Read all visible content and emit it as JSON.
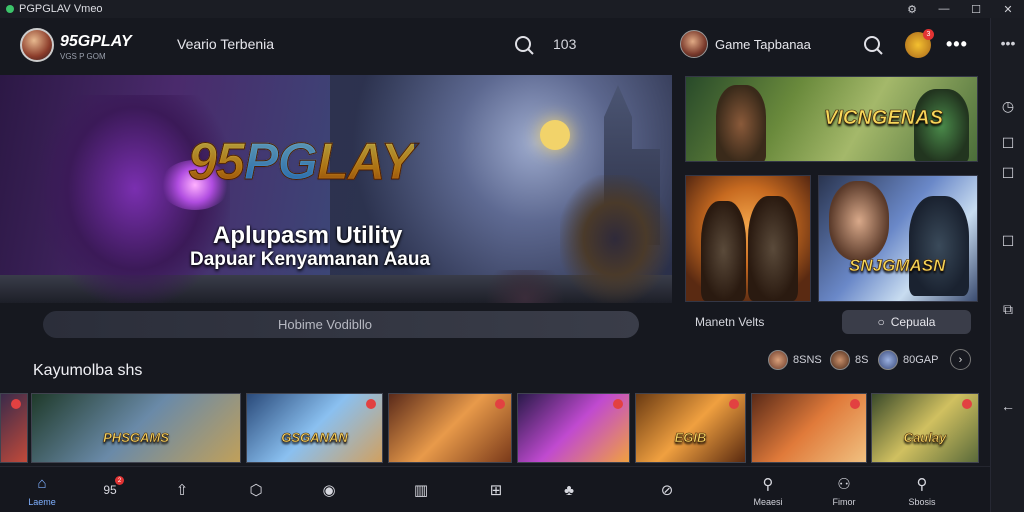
{
  "window": {
    "title": "PGPGLAV Vmeo",
    "controls": [
      "⚙",
      "—",
      "☐",
      "✕"
    ]
  },
  "header": {
    "brand_name": "95GPLAY",
    "brand_sub": "VGS P GOM",
    "nav_title": "Veario Terbenia",
    "search_count": "103",
    "game_label": "Game Tapbanaa",
    "notification_count": "3",
    "more": "•••"
  },
  "hero": {
    "logo_a": "95",
    "logo_b": "PG",
    "logo_c": "LAY",
    "title": "Aplupasm Utility",
    "subtitle": "Dapuar Kenyamanan Aaua"
  },
  "tiles": {
    "a_title": "VICNGENAS",
    "c_title": "SNJGMASN"
  },
  "search": {
    "placeholder": "Hobime Vodibllo"
  },
  "nav_label": "Manetn Velts",
  "pill_button": {
    "icon": "○",
    "label": "Cepuala"
  },
  "section": {
    "title": "Kayumolba shs"
  },
  "stats": [
    {
      "value": "8SNS",
      "color": "#a86a4a"
    },
    {
      "value": "8S",
      "color": "#6a4a3a"
    },
    {
      "value": "80GAP",
      "color": "#4a6aa8"
    }
  ],
  "carousel": {
    "cards": [
      {
        "title": "",
        "c1": "#3a2a4a",
        "c2": "#c24a3a"
      },
      {
        "title": "PHSGAMS",
        "c1": "#1f3a2a",
        "c2": "#6a8aa8"
      },
      {
        "title": "GSGANAN",
        "c1": "#2a4a7a",
        "c2": "#8ac0f0"
      },
      {
        "title": "",
        "c1": "#5a2a1a",
        "c2": "#e89a4a"
      },
      {
        "title": "",
        "c1": "#2a1a4a",
        "c2": "#c04ad0"
      },
      {
        "title": "EGIB",
        "c1": "#6a3a12",
        "c2": "#f0a040"
      },
      {
        "title": "",
        "c1": "#5a2a18",
        "c2": "#e07a3a"
      },
      {
        "title": "Caulay",
        "c1": "#3a4a2a",
        "c2": "#d0c060"
      }
    ]
  },
  "bottom_nav": [
    {
      "icon": "⌂",
      "label": "Laeme",
      "active": true
    },
    {
      "icon": "",
      "label": "",
      "text_icon": "95",
      "badge": "2"
    },
    {
      "icon": "⇧",
      "label": ""
    },
    {
      "icon": "⬡",
      "label": ""
    },
    {
      "icon": "◉",
      "label": ""
    },
    {
      "icon": "▥",
      "label": ""
    },
    {
      "icon": "⊞",
      "label": ""
    },
    {
      "icon": "♣",
      "label": ""
    },
    {
      "icon": "⊘",
      "label": ""
    },
    {
      "icon": "⚲",
      "label": "Meaesi"
    },
    {
      "icon": "⚇",
      "label": "Fimor"
    },
    {
      "icon": "⚲",
      "label": "Sbosis"
    }
  ],
  "rail_icons": [
    "◷",
    "☐",
    "☐",
    "☐",
    "⧉",
    "←"
  ]
}
